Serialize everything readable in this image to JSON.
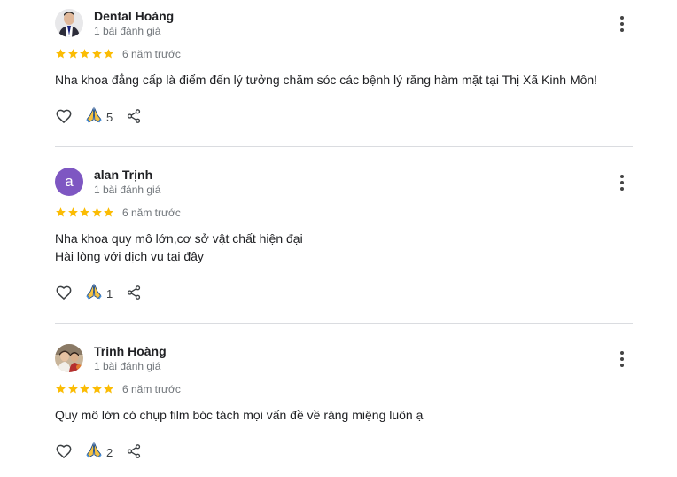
{
  "colors": {
    "star": "#fbbc04",
    "avatar_letter_bg": "#7e57c2",
    "icon": "#3c4043"
  },
  "reviews": [
    {
      "author": "Dental Hoàng",
      "review_count": "1 bài đánh giá",
      "rating": 5,
      "date": "6 năm trước",
      "text_lines": [
        "Nha khoa đẳng cấp là điểm đến lý tưởng chăm sóc các bệnh lý răng hàm mặt tại Thị Xã Kinh Môn!"
      ],
      "likes": "5",
      "avatar": "photo"
    },
    {
      "author": "alan Trịnh",
      "review_count": "1 bài đánh giá",
      "rating": 5,
      "date": "6 năm trước",
      "text_lines": [
        "Nha khoa quy mô lớn,cơ sở vật chất hiện đại",
        "Hài lòng với dịch vụ tại đây"
      ],
      "likes": "1",
      "avatar": "a"
    },
    {
      "author": "Trinh Hoàng",
      "review_count": "1 bài đánh giá",
      "rating": 5,
      "date": "6 năm trước",
      "text_lines": [
        "Quy mô lớn có chụp film bóc tách mọi vấn đề về răng miệng luôn ạ"
      ],
      "likes": "2",
      "avatar": "photo"
    }
  ],
  "icons": {
    "like": "heart-icon",
    "reaction": "folded-hands-icon",
    "share": "share-icon",
    "more": "more-vert-icon",
    "star": "star-icon"
  }
}
